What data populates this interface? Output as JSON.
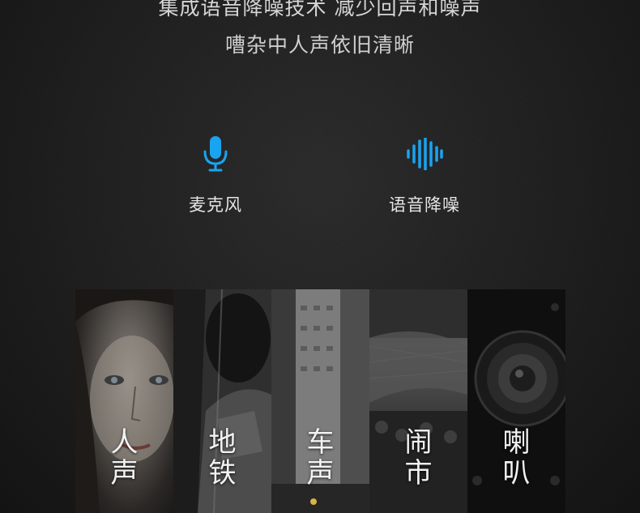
{
  "headline": {
    "line1": "集成语音降噪技术 减少回声和噪声",
    "line2": "嘈杂中人声依旧清晰"
  },
  "features": [
    {
      "icon": "microphone-icon",
      "label": "麦克风"
    },
    {
      "icon": "sound-wave-icon",
      "label": "语音降噪"
    }
  ],
  "accent_color": "#1aa3f0",
  "scenes": [
    {
      "caption": "人声"
    },
    {
      "caption": "地铁"
    },
    {
      "caption": "车声"
    },
    {
      "caption": "闹市"
    },
    {
      "caption": "喇叭"
    }
  ]
}
